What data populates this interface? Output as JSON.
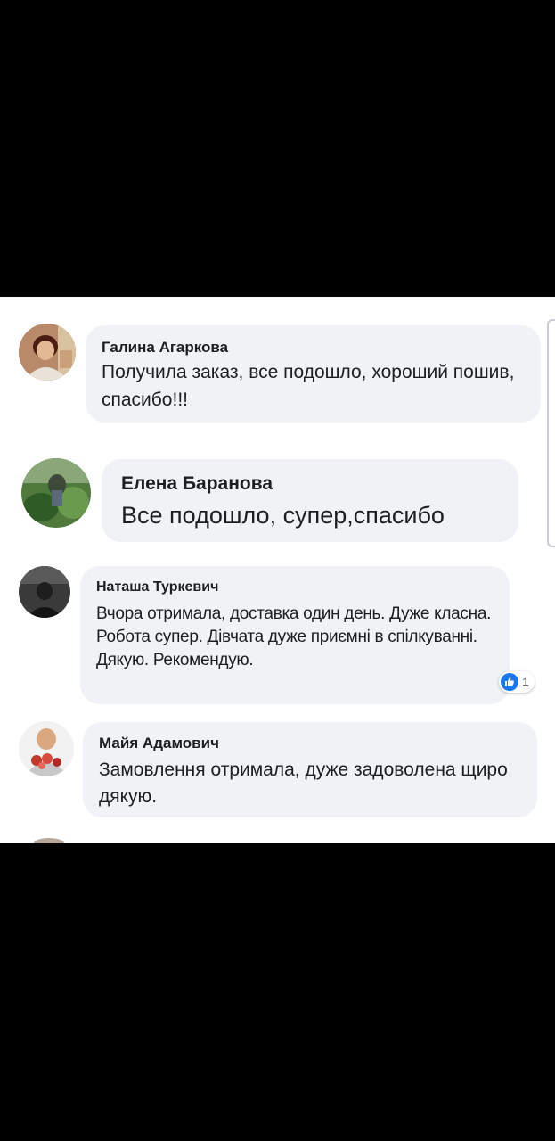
{
  "comments": [
    {
      "author": "Галина Агаркова",
      "text": "Получила заказ, все подошло, хороший пошив, спасибо!!!",
      "avatar_icon": "woman-portrait-avatar"
    },
    {
      "author": "Елена Баранова",
      "text": "Все подошло, супер,спасибо",
      "avatar_icon": "garden-plants-avatar"
    },
    {
      "author": "Наташа Туркевич",
      "text": "Вчора отримала, доставка один день. Дуже класна. Робота супер. Дівчата дуже приємні в спілкуванні. Дякую. Рекомендую.",
      "avatar_icon": "dark-portrait-avatar",
      "reaction": {
        "icon": "like-icon",
        "count": "1"
      }
    },
    {
      "author": "Майя Адамович",
      "text": "Замовлення отримала, дуже задоволена щиро дякую.",
      "avatar_icon": "woman-with-flowers-avatar"
    }
  ],
  "colors": {
    "bubble": "#f0f2f5",
    "text": "#1c1e21",
    "like": "#1877f2"
  }
}
